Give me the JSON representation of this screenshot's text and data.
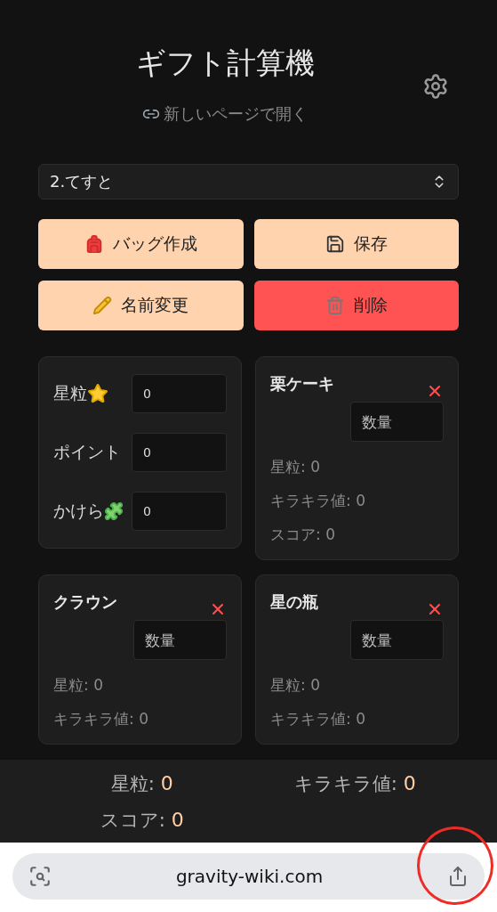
{
  "header": {
    "title": "ギフト計算機",
    "link": "新しいページで開く"
  },
  "bag_select": {
    "value": "2.てすと"
  },
  "buttons": [
    {
      "label": "バッグ作成",
      "kind": "normal"
    },
    {
      "label": "保存",
      "kind": "normal"
    },
    {
      "label": "名前変更",
      "kind": "normal"
    },
    {
      "label": "削除",
      "kind": "danger"
    }
  ],
  "inputs_card": {
    "fields": [
      {
        "label": "星粒",
        "value": "0"
      },
      {
        "label": "ポイント",
        "value": "0"
      },
      {
        "label": "かけら",
        "value": "0"
      }
    ]
  },
  "items": [
    {
      "name": "栗ケーキ",
      "placeholder": "数量",
      "stats": [
        "星粒: 0",
        "キラキラ値: 0",
        "スコア: 0"
      ]
    },
    {
      "name": "クラウン",
      "placeholder": "数量",
      "stats": [
        "星粒: 0",
        "キラキラ値: 0"
      ]
    },
    {
      "name": "星の瓶",
      "placeholder": "数量",
      "stats": [
        "星粒: 0",
        "キラキラ値: 0"
      ]
    }
  ],
  "totals": [
    {
      "label": "星粒:",
      "value": "0"
    },
    {
      "label": "キラキラ値:",
      "value": "0"
    },
    {
      "label": "スコア:",
      "value": "0"
    }
  ],
  "browser_bar": {
    "url": "gravity-wiki.com"
  }
}
